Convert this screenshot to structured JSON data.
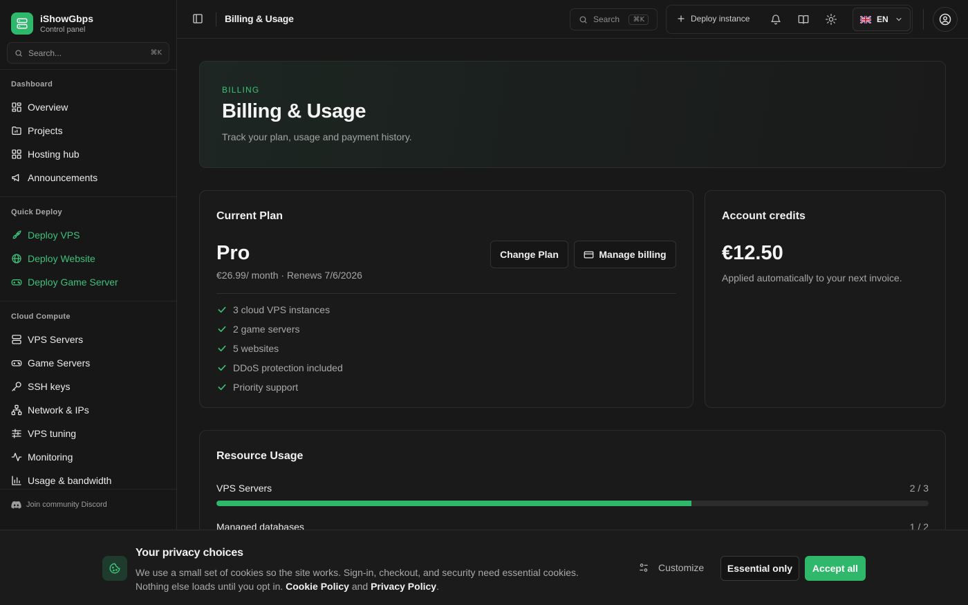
{
  "brand": {
    "name": "iShowGbps",
    "subtitle": "Control panel"
  },
  "sidebar": {
    "search_placeholder": "Search...",
    "search_shortcut": "⌘K",
    "sections": {
      "dashboard": "Dashboard",
      "quick_deploy": "Quick Deploy",
      "cloud_compute": "Cloud Compute"
    },
    "dashboard_items": [
      "Overview",
      "Projects",
      "Hosting hub",
      "Announcements"
    ],
    "quick_deploy_items": [
      "Deploy VPS",
      "Deploy Website",
      "Deploy Game Server"
    ],
    "cloud_items": [
      "VPS Servers",
      "Game Servers",
      "SSH keys",
      "Network & IPs",
      "VPS tuning",
      "Monitoring",
      "Usage & bandwidth"
    ],
    "footer": "Join community Discord"
  },
  "topbar": {
    "title": "Billing & Usage",
    "search_placeholder": "Search",
    "search_shortcut": "⌘K",
    "deploy_label": "Deploy instance",
    "language": "EN"
  },
  "hero": {
    "eyebrow": "BILLING",
    "title": "Billing & Usage",
    "description": "Track your plan, usage and payment history."
  },
  "plan": {
    "card_title": "Current Plan",
    "name": "Pro",
    "meta": "€26.99/ month · Renews 7/6/2026",
    "change_label": "Change Plan",
    "manage_label": "Manage billing",
    "features": [
      "3 cloud VPS instances",
      "2 game servers",
      "5 websites",
      "DDoS protection included",
      "Priority support"
    ]
  },
  "credits": {
    "card_title": "Account credits",
    "value": "€12.50",
    "note": "Applied automatically to your next invoice."
  },
  "usage": {
    "card_title": "Resource Usage",
    "items": [
      {
        "label": "VPS Servers",
        "count": "2 / 3",
        "fraction": 0.667
      },
      {
        "label": "Managed databases",
        "count": "1 / 2",
        "fraction": 0.5
      }
    ]
  },
  "cookie": {
    "title": "Your privacy choices",
    "text_1": "We use a small set of cookies so the site works. Sign-in, checkout, and security need essential cookies.",
    "text_2": "Nothing else loads until you opt in.",
    "cookie_policy": "Cookie Policy",
    "and": "and",
    "privacy_policy": "Privacy Policy",
    "period": ".",
    "customize_label": "Customize",
    "essential_label": "Essential only",
    "accept_label": "Accept all"
  },
  "colors": {
    "accent": "#2fb86b",
    "background": "#181818",
    "card": "#1a1a1a"
  }
}
